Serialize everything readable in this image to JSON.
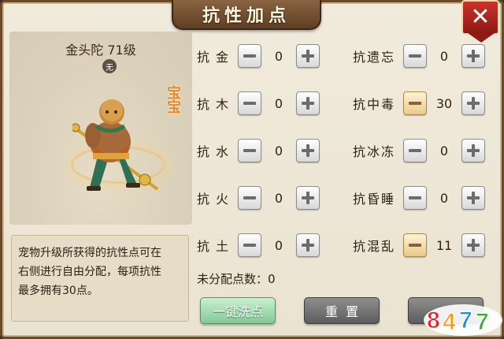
{
  "title": "抗性加点",
  "close_icon": "close-icon",
  "pet": {
    "name": "金头陀 71级",
    "badge": "无",
    "tag": "宝宝"
  },
  "description": {
    "line1": "宠物升级所获得的抗性点可在",
    "line2": "右侧进行自由分配，每项抗性",
    "line3": "最多拥有30点。"
  },
  "resist_left": [
    {
      "label": "抗金",
      "value": "0"
    },
    {
      "label": "抗木",
      "value": "0"
    },
    {
      "label": "抗水",
      "value": "0"
    },
    {
      "label": "抗火",
      "value": "0"
    },
    {
      "label": "抗土",
      "value": "0"
    }
  ],
  "resist_right": [
    {
      "label": "抗遗忘",
      "value": "0"
    },
    {
      "label": "抗中毒",
      "value": "30"
    },
    {
      "label": "抗冰冻",
      "value": "0"
    },
    {
      "label": "抗昏睡",
      "value": "0"
    },
    {
      "label": "抗混乱",
      "value": "11"
    }
  ],
  "unassigned": "未分配点数：0",
  "buttons": {
    "reset_all": "一键洗点",
    "reset": "重置"
  },
  "watermark": "8477",
  "colors": {
    "frame": "#6b4a2c",
    "close": "#c9332a",
    "green_button": "#83c998",
    "highlight": "#e6892a"
  }
}
